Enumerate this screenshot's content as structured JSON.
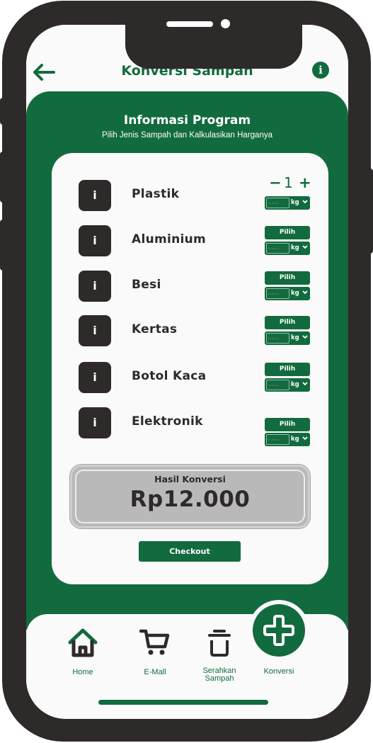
{
  "header": {
    "title": "Konversi Sampah",
    "back_icon": "arrow-left-icon",
    "info_icon": "info-icon",
    "info_glyph": "i"
  },
  "program": {
    "title": "Informasi Program",
    "subtitle": "Pilih Jenis Sampah dan Kalkulasikan Harganya"
  },
  "items": [
    {
      "label": "Plastik",
      "info_glyph": "i",
      "quantity": "1",
      "minus": "−",
      "plus": "+",
      "weight_placeholder": "isi berat",
      "unit": "kg"
    },
    {
      "label": "Aluminium",
      "info_glyph": "i",
      "button": "Pilih",
      "weight_placeholder": "isi berat",
      "unit": "kg"
    },
    {
      "label": "Besi",
      "info_glyph": "i",
      "button": "Pilih",
      "weight_placeholder": "isi berat",
      "unit": "kg"
    },
    {
      "label": "Kertas",
      "info_glyph": "i",
      "button": "Pilih",
      "weight_placeholder": "isi berat",
      "unit": "kg"
    },
    {
      "label": "Botol Kaca",
      "info_glyph": "i",
      "button": "Pilih",
      "weight_placeholder": "isi berat",
      "unit": "kg"
    },
    {
      "label": "Elektronik",
      "info_glyph": "i",
      "button": "Pilih",
      "weight_placeholder": "isi berat",
      "unit": "kg"
    }
  ],
  "result": {
    "label": "Hasil Konversi",
    "value": "Rp12.000"
  },
  "checkout_label": "Checkout",
  "nav": {
    "home": {
      "label": "Home",
      "icon": "home-icon"
    },
    "emall": {
      "label": "E-Mall",
      "icon": "cart-icon"
    },
    "serahkan": {
      "label_line1": "Serahkan",
      "label_line2": "Sampah",
      "icon": "trash-icon"
    },
    "konversi": {
      "label": "Konversi",
      "icon": "plus-icon"
    }
  },
  "colors": {
    "primary": "#126b3e",
    "dark": "#2e2a29",
    "result_bg": "#b9b9b9"
  }
}
